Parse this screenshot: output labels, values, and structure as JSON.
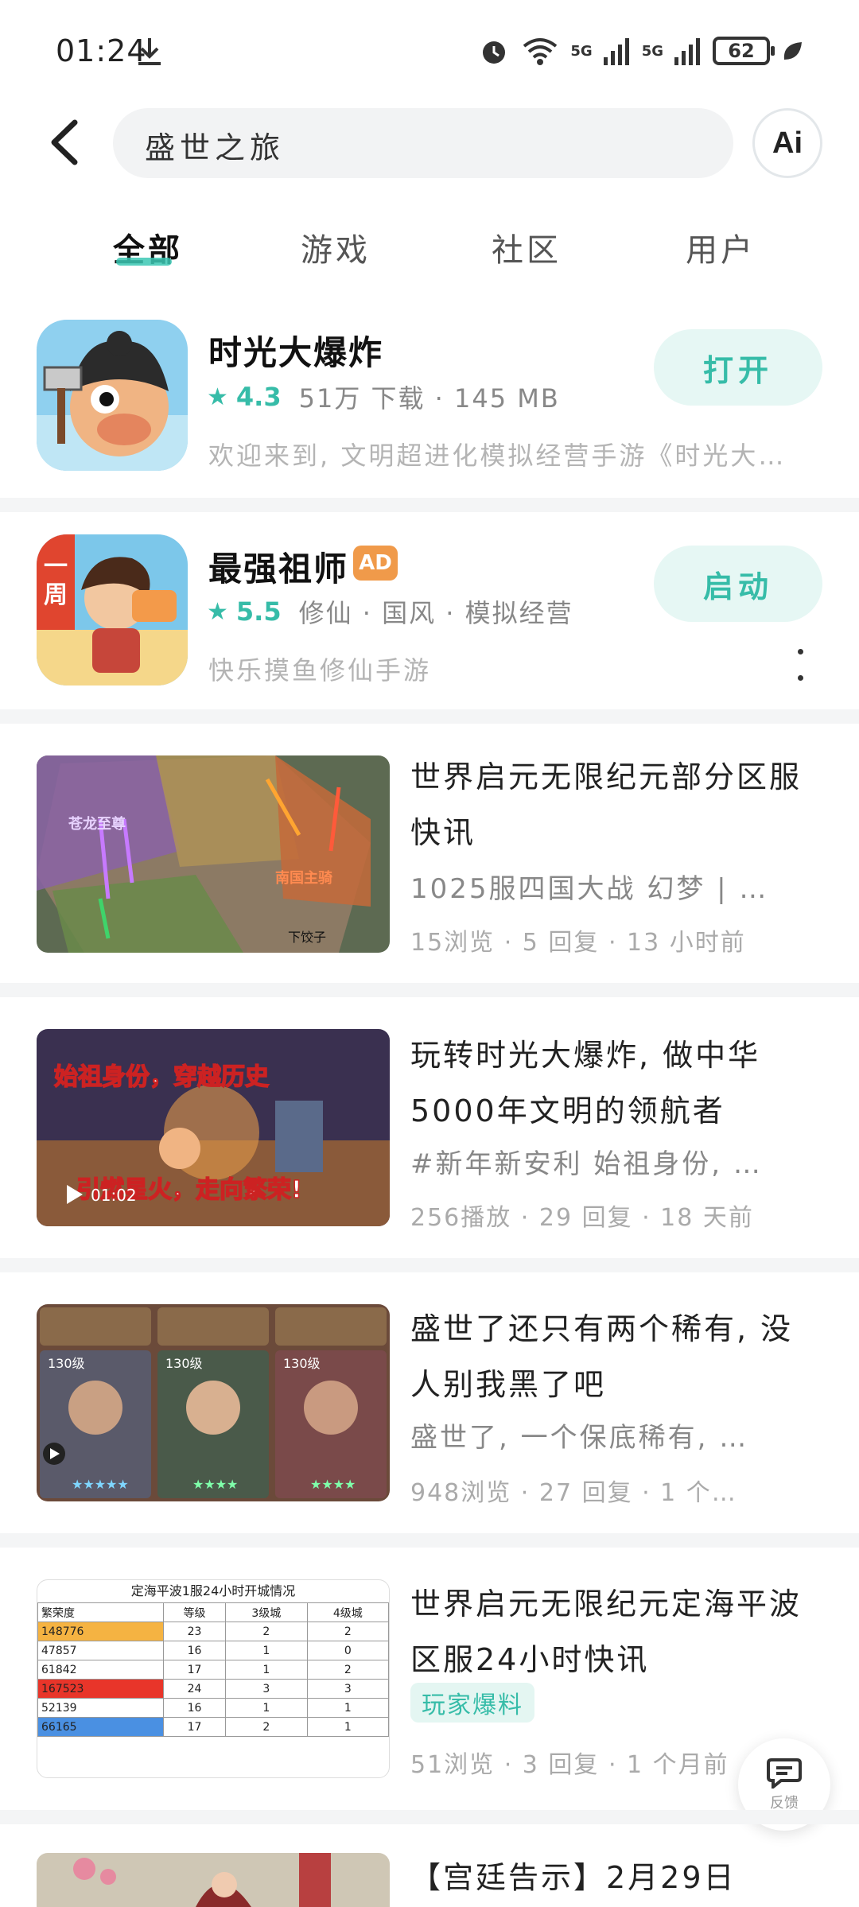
{
  "status_bar": {
    "time": "01:24",
    "signal1": "5G",
    "signal2": "5G",
    "battery": "62"
  },
  "search": {
    "query": "盛世之旅",
    "ai_label": "Ai"
  },
  "tabs": [
    {
      "label": "全部"
    },
    {
      "label": "游戏"
    },
    {
      "label": "社区"
    },
    {
      "label": "用户"
    }
  ],
  "apps": [
    {
      "name": "时光大爆炸",
      "rating": "4.3",
      "meta": "51万 下载 · 145 MB",
      "desc": "欢迎来到, 文明超进化模拟经营手游《时光大…",
      "button": "打开"
    },
    {
      "name": "最强祖师",
      "badge": "AD",
      "rating": "5.5",
      "meta": "修仙 · 国风 · 模拟经营",
      "desc": "快乐摸鱼修仙手游",
      "button": "启动"
    }
  ],
  "posts": [
    {
      "title": "世界启元无限纪元部分区服快讯",
      "sub": "1025服四国大战 幻梦 | …",
      "meta": "15浏览 · 5 回复 · 13 小时前",
      "thumb_labels": {
        "left": "苍龙至尊",
        "right": "南国主骑",
        "corner": "下饺子"
      }
    },
    {
      "title": "玩转时光大爆炸, 做中华5000年文明的领航者",
      "sub": "#新年新安利 始祖身份, …",
      "meta": "256播放 · 29 回复 · 18 天前",
      "thumb_labels": {
        "top": "始祖身份，穿越历史",
        "bottom": "引燃星火，走向繁荣!",
        "duration": "01:02"
      }
    },
    {
      "title": "盛世了还只有两个稀有, 没人别我黑了吧",
      "sub": "盛世了, 一个保底稀有, …",
      "meta": "948浏览 · 27 回复 · 1 个…",
      "thumb_labels": {
        "lv1": "130级",
        "lv2": "130级",
        "lv3": "130级"
      }
    },
    {
      "title": "世界启元无限纪元定海平波区服24小时快讯",
      "tag": "玩家爆料",
      "meta": "51浏览 · 3 回复 · 1 个月前",
      "table": {
        "title": "定海平波1服24小时开城情况",
        "headers": [
          "繁荣度",
          "等级",
          "3级城",
          "4级城"
        ],
        "rows": [
          [
            "148776",
            "23",
            "2",
            "2"
          ],
          [
            "47857",
            "16",
            "1",
            "0"
          ],
          [
            "61842",
            "17",
            "1",
            "2"
          ],
          [
            "167523",
            "24",
            "3",
            "3"
          ],
          [
            "52139",
            "16",
            "1",
            "1"
          ],
          [
            "66165",
            "17",
            "2",
            "1"
          ]
        ]
      }
    },
    {
      "title": "【宫廷告示】2月29日"
    }
  ],
  "feedback_label": "反馈",
  "colors": {
    "accent": "#36bca8",
    "ad": "#f09a4a",
    "highlight_orange": "#f5b342",
    "highlight_red": "#e8352a",
    "highlight_blue": "#4a90e2"
  }
}
